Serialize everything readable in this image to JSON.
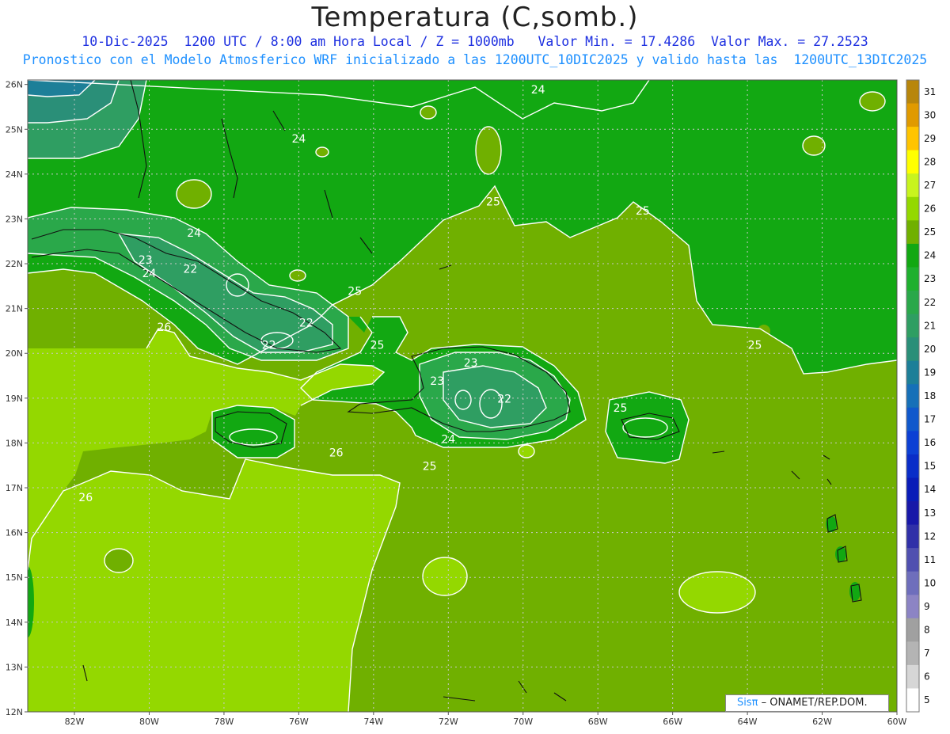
{
  "title": "Temperatura (C,somb.)",
  "subtitle_line1": "10-Dic-2025  1200 UTC / 8:00 am Hora Local / Z = 1000mb   Valor Min. = 17.4286  Valor Max. = 27.2523",
  "subtitle_line2": "Pronostico con el Modelo Atmosferico WRF inicializado a las 1200UTC_10DIC2025 y valido hasta las  1200UTC_13DIC2025",
  "lat_labels": [
    "26N",
    "25N",
    "24N",
    "23N",
    "22N",
    "21N",
    "20N",
    "19N",
    "18N",
    "17N",
    "16N",
    "15N",
    "14N",
    "13N",
    "12N"
  ],
  "lon_labels": [
    "82W",
    "80W",
    "78W",
    "76W",
    "74W",
    "72W",
    "70W",
    "68W",
    "66W",
    "64W",
    "62W",
    "60W"
  ],
  "colorbar": {
    "labels": [
      "31",
      "30",
      "29",
      "28",
      "27",
      "26",
      "25",
      "24",
      "23",
      "22",
      "21",
      "20",
      "19",
      "18",
      "17",
      "16",
      "15",
      "14",
      "13",
      "12",
      "11",
      "10",
      "9",
      "8",
      "7",
      "6",
      "5"
    ],
    "colors": [
      "#b8860b",
      "#e09a00",
      "#ffc400",
      "#ffff00",
      "#c8f41e",
      "#94d800",
      "#70b000",
      "#12a812",
      "#1fb02e",
      "#2aa84a",
      "#2f9e62",
      "#2a8f78",
      "#1d7f98",
      "#1670b8",
      "#1058cc",
      "#0c40d4",
      "#0a2dc8",
      "#0a1cb8",
      "#1818a8",
      "#3030a8",
      "#5050b0",
      "#6e6ebc",
      "#8c84c4",
      "#a0a0a0",
      "#b4b4b4",
      "#d6d6d6",
      "#ffffff"
    ]
  },
  "contour_labels": [
    {
      "value": "24",
      "lon": -76.0,
      "lat": 24.7
    },
    {
      "value": "24",
      "lon": -69.6,
      "lat": 25.8
    },
    {
      "value": "25",
      "lon": -70.8,
      "lat": 23.3
    },
    {
      "value": "25",
      "lon": -66.8,
      "lat": 23.1
    },
    {
      "value": "24",
      "lon": -78.8,
      "lat": 22.6
    },
    {
      "value": "23",
      "lon": -80.1,
      "lat": 22.0
    },
    {
      "value": "24",
      "lon": -80.0,
      "lat": 21.7
    },
    {
      "value": "22",
      "lon": -78.9,
      "lat": 21.8
    },
    {
      "value": "25",
      "lon": -74.5,
      "lat": 21.3
    },
    {
      "value": "26",
      "lon": -79.6,
      "lat": 20.5
    },
    {
      "value": "22",
      "lon": -75.8,
      "lat": 20.6
    },
    {
      "value": "22",
      "lon": -76.8,
      "lat": 20.1
    },
    {
      "value": "25",
      "lon": -73.9,
      "lat": 20.1
    },
    {
      "value": "25",
      "lon": -63.8,
      "lat": 20.1
    },
    {
      "value": "23",
      "lon": -71.4,
      "lat": 19.7
    },
    {
      "value": "23",
      "lon": -72.3,
      "lat": 19.3
    },
    {
      "value": "22",
      "lon": -70.5,
      "lat": 18.9
    },
    {
      "value": "25",
      "lon": -67.4,
      "lat": 18.7
    },
    {
      "value": "24",
      "lon": -72.0,
      "lat": 18.0
    },
    {
      "value": "26",
      "lon": -75.0,
      "lat": 17.7
    },
    {
      "value": "25",
      "lon": -72.5,
      "lat": 17.4
    },
    {
      "value": "26",
      "lon": -81.7,
      "lat": 16.7
    }
  ],
  "credit": {
    "logo": "Sisπ",
    "text": " – ONAMET/REP.DOM."
  }
}
